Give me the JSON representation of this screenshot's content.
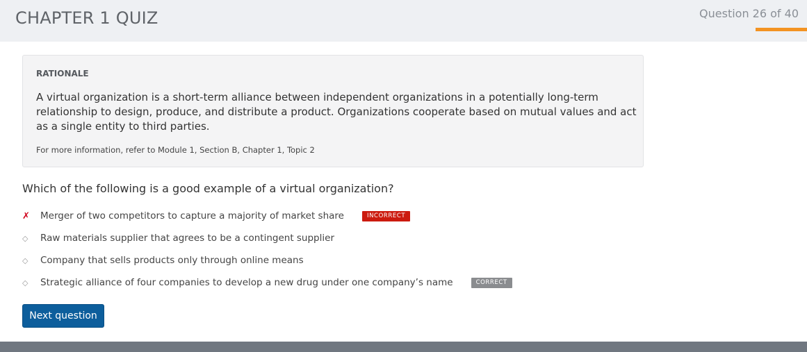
{
  "header": {
    "title": "CHAPTER 1 QUIZ",
    "progress_text": "Question 26 of 40",
    "progress_fraction": 0.65,
    "accent_color": "#f39322"
  },
  "rationale": {
    "label": "RATIONALE",
    "text": "A virtual organization is a short-term alliance between independent organizations in a potentially long-term relationship to design, produce, and distribute a product. Organizations cooperate based on mutual values and act as a single entity to third parties.",
    "reference": "For more information, refer to Module 1, Section B, Chapter 1, Topic 2"
  },
  "question": {
    "text": "Which of the following is a good example of a virtual organization?"
  },
  "answers": [
    {
      "marker": "✗",
      "marker_icon": "x-mark-icon",
      "text": "Merger of two competitors to capture a majority of market share",
      "badge": "INCORRECT",
      "badge_color": "#cc1b0f"
    },
    {
      "marker": "◇",
      "marker_icon": "diamond-bullet-icon",
      "text": "Raw materials supplier that agrees to be a contingent supplier"
    },
    {
      "marker": "◇",
      "marker_icon": "diamond-bullet-icon",
      "text": "Company that sells products only through online means"
    },
    {
      "marker": "◇",
      "marker_icon": "diamond-bullet-icon",
      "text": "Strategic alliance of four companies to develop a new drug under one company’s name",
      "badge": "CORRECT",
      "badge_color": "#8a8c8f"
    }
  ],
  "next_button": {
    "label": "Next question",
    "color": "#0d5e9c"
  }
}
